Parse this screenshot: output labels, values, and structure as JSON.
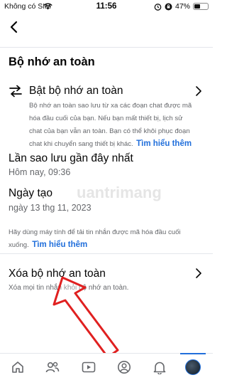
{
  "status_bar": {
    "carrier": "Không có SIM",
    "time": "11:56",
    "battery_text": "47%",
    "battery_level": 0.47
  },
  "page": {
    "title": "Bộ nhớ an toàn"
  },
  "toggle_section": {
    "title": "Bật bộ nhớ an toàn",
    "description": "Bộ nhớ an toàn sao lưu từ xa các đoạn chat được mã hóa đầu cuối của bạn. Nếu bạn mất thiết bị, lịch sử chat của bạn vẫn an toàn. Bạn có thể khôi phục đoạn chat khi chuyển sang thiết bị khác.",
    "link": "Tìm hiểu thêm"
  },
  "last_backup": {
    "title": "Lần sao lưu gần đây nhất",
    "value": "Hôm nay, 09:36"
  },
  "created": {
    "title": "Ngày tạo",
    "value": "ngày 13 thg 11, 2023"
  },
  "info": {
    "text": "Hãy dùng máy tính để tải tin nhắn được mã hóa đầu cuối xuống.",
    "link": "Tìm hiểu thêm"
  },
  "delete_section": {
    "title": "Xóa bộ nhớ an toàn",
    "description": "Xóa mọi tin nhắn khỏi bộ nhớ an toàn."
  },
  "watermark": "uantrimang",
  "bottom_nav": {
    "items": [
      "home-icon",
      "friends-icon",
      "video-icon",
      "profile-icon",
      "notifications-icon",
      "avatar"
    ],
    "active": "avatar"
  },
  "colors": {
    "accent": "#216fdb",
    "arrow": "#e02020"
  }
}
